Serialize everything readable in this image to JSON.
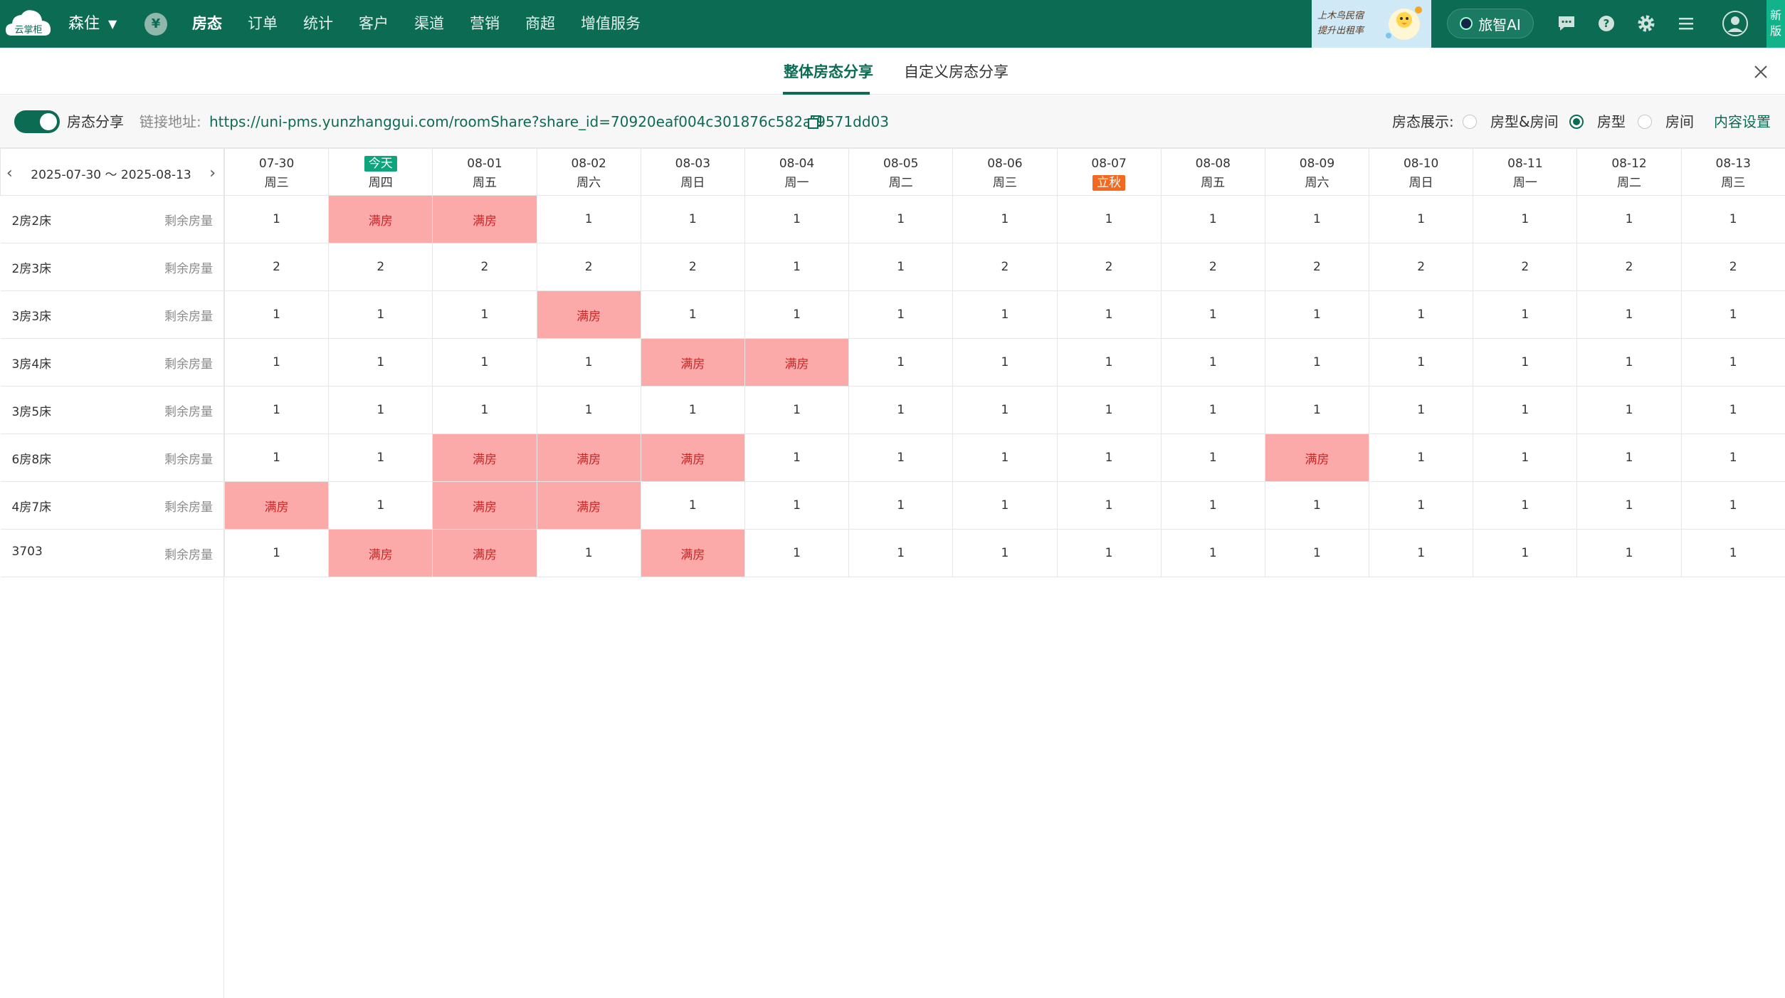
{
  "app": {
    "logo_text": "云掌柜",
    "hotel_name": "森住",
    "money_symbol": "¥",
    "ai_label": "旅智AI",
    "new_version": "新版",
    "banner_text": "上木鸟民宿 提升出租率"
  },
  "nav": [
    "房态",
    "订单",
    "统计",
    "客户",
    "渠道",
    "营销",
    "商超",
    "增值服务"
  ],
  "tabs": {
    "whole": "整体房态分享",
    "custom": "自定义房态分享"
  },
  "toolbar": {
    "share_label": "房态分享",
    "link_label": "链接地址:",
    "link_url": "https://uni-pms.yunzhanggui.com/roomShare?share_id=70920eaf004c301876c582af9571dd03",
    "display_label": "房态展示:",
    "options": [
      "房型&房间",
      "房型",
      "房间"
    ],
    "selected": "房型",
    "settings": "内容设置"
  },
  "calendar": {
    "range": "2025-07-30 ～ 2025-08-13",
    "row_label": "剩余房量",
    "full_text": "满房",
    "days": [
      {
        "date": "07-30",
        "week": "周三"
      },
      {
        "date": "",
        "week": "周四",
        "badge": "今天",
        "badge_type": "today"
      },
      {
        "date": "08-01",
        "week": "周五"
      },
      {
        "date": "08-02",
        "week": "周六"
      },
      {
        "date": "08-03",
        "week": "周日"
      },
      {
        "date": "08-04",
        "week": "周一"
      },
      {
        "date": "08-05",
        "week": "周二"
      },
      {
        "date": "08-06",
        "week": "周三"
      },
      {
        "date": "08-07",
        "week": "",
        "badge": "立秋",
        "badge_type": "festival"
      },
      {
        "date": "08-08",
        "week": "周五"
      },
      {
        "date": "08-09",
        "week": "周六"
      },
      {
        "date": "08-10",
        "week": "周日"
      },
      {
        "date": "08-11",
        "week": "周一"
      },
      {
        "date": "08-12",
        "week": "周二"
      },
      {
        "date": "08-13",
        "week": "周三"
      }
    ],
    "rows": [
      {
        "name": "2房2床",
        "values": [
          "1",
          "满房",
          "满房",
          "1",
          "1",
          "1",
          "1",
          "1",
          "1",
          "1",
          "1",
          "1",
          "1",
          "1",
          "1"
        ]
      },
      {
        "name": "2房3床",
        "values": [
          "2",
          "2",
          "2",
          "2",
          "2",
          "1",
          "1",
          "2",
          "2",
          "2",
          "2",
          "2",
          "2",
          "2",
          "2"
        ]
      },
      {
        "name": "3房3床",
        "values": [
          "1",
          "1",
          "1",
          "满房",
          "1",
          "1",
          "1",
          "1",
          "1",
          "1",
          "1",
          "1",
          "1",
          "1",
          "1"
        ]
      },
      {
        "name": "3房4床",
        "values": [
          "1",
          "1",
          "1",
          "1",
          "满房",
          "满房",
          "1",
          "1",
          "1",
          "1",
          "1",
          "1",
          "1",
          "1",
          "1"
        ]
      },
      {
        "name": "3房5床",
        "values": [
          "1",
          "1",
          "1",
          "1",
          "1",
          "1",
          "1",
          "1",
          "1",
          "1",
          "1",
          "1",
          "1",
          "1",
          "1"
        ]
      },
      {
        "name": "6房8床",
        "values": [
          "1",
          "1",
          "满房",
          "满房",
          "满房",
          "1",
          "1",
          "1",
          "1",
          "1",
          "满房",
          "1",
          "1",
          "1",
          "1"
        ]
      },
      {
        "name": "4房7床",
        "values": [
          "满房",
          "1",
          "满房",
          "满房",
          "1",
          "1",
          "1",
          "1",
          "1",
          "1",
          "1",
          "1",
          "1",
          "1",
          "1"
        ]
      },
      {
        "name": "3703",
        "values": [
          "1",
          "满房",
          "满房",
          "1",
          "满房",
          "1",
          "1",
          "1",
          "1",
          "1",
          "1",
          "1",
          "1",
          "1",
          "1"
        ]
      }
    ]
  }
}
